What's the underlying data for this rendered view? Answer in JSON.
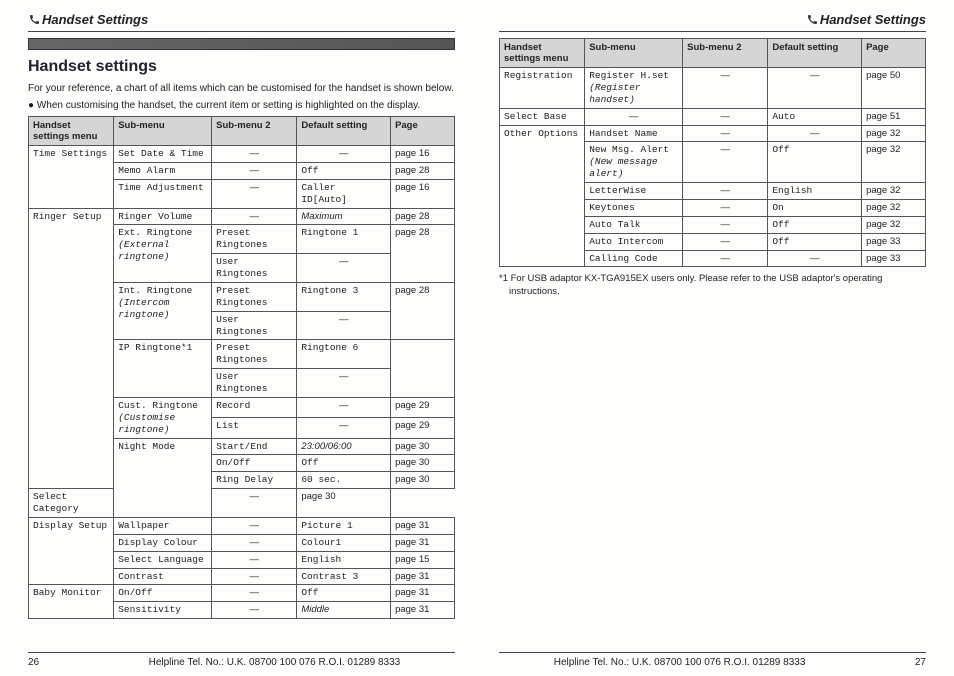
{
  "header_title": "Handset Settings",
  "section_title": "Handset settings",
  "intro": "For your reference, a chart of all items which can be customised for the handset is shown below.",
  "bullet": "● When customising the handset, the current item or setting is highlighted on the display.",
  "columns": {
    "c1": "Handset settings menu",
    "c2": "Sub-menu",
    "c3": "Sub-menu 2",
    "c4": "Default setting",
    "c5": "Page"
  },
  "left_rows": [
    {
      "menu": "Time Settings",
      "sub": "Set Date & Time",
      "sub2": "—",
      "def": "—",
      "page": "page 16",
      "menu_rowspan": 3,
      "mono_sub": true
    },
    {
      "sub": "Memo Alarm",
      "sub2": "—",
      "def": "Off",
      "page": "page 28",
      "mono_sub": true,
      "mono_def": true
    },
    {
      "sub": "Time Adjustment",
      "sub2": "—",
      "def": "Caller ID[Auto]",
      "page": "page 16",
      "mono_sub": true,
      "mono_def": true
    },
    {
      "menu": "Ringer Setup",
      "sub": "Ringer Volume",
      "sub2": "—",
      "def": "Maximum",
      "def_italic": true,
      "page": "page 28",
      "menu_rowspan": 12,
      "mono_sub": true
    },
    {
      "sub": "Ext. Ringtone",
      "sub_note": "(External ringtone)",
      "sub2": "Preset Ringtones",
      "def": "Ringtone  1",
      "page": "page 28",
      "sub_rowspan": 2,
      "mono_sub": true,
      "mono_sub2": true,
      "mono_def": true
    },
    {
      "sub2": "User Ringtones",
      "def": "—",
      "page": "",
      "mono_sub2": true,
      "page_merge_up": true
    },
    {
      "sub": "Int. Ringtone",
      "sub_note": "(Intercom ringtone)",
      "sub2": "Preset Ringtones",
      "def": "Ringtone  3",
      "page": "page 28",
      "sub_rowspan": 2,
      "mono_sub": true,
      "mono_sub2": true,
      "mono_def": true
    },
    {
      "sub2": "User Ringtones",
      "def": "—",
      "page": "",
      "mono_sub2": true,
      "page_merge_up": true
    },
    {
      "sub": "IP Ringtone*1",
      "sub2": "Preset Ringtones",
      "def": "Ringtone  6",
      "page": "",
      "sub_rowspan": 2,
      "page_rowspan": 2,
      "mono_sub": true,
      "mono_sub2": true,
      "mono_def": true,
      "def_rowspan": 1
    },
    {
      "sub2": "User Ringtones",
      "def": "—",
      "mono_sub2": true,
      "page_skip": true
    },
    {
      "sub": "Cust. Ringtone",
      "sub_note": "(Customise ringtone)",
      "sub2": "Record",
      "def": "—",
      "page": "page 29",
      "sub_rowspan": 2,
      "mono_sub": true,
      "mono_sub2": true
    },
    {
      "sub2": "List",
      "def": "—",
      "page": "page 29",
      "mono_sub2": true
    },
    {
      "sub": "Night Mode",
      "sub2": "Start/End",
      "def": "23:00/06:00",
      "def_italic": true,
      "page": "page 30",
      "sub_rowspan": 4,
      "mono_sub": true,
      "mono_sub2": true
    },
    {
      "sub2": "On/Off",
      "def": "Off",
      "page": "page 30",
      "mono_sub2": true,
      "mono_def": true
    },
    {
      "sub2": "Ring Delay",
      "def": "60 sec.",
      "page": "page 30",
      "mono_sub2": true,
      "mono_def": true
    },
    {
      "sub2": "Select Category",
      "def": "—",
      "page": "page 30",
      "mono_sub2": true
    },
    {
      "menu": "Display Setup",
      "sub": "Wallpaper",
      "sub2": "—",
      "def": "Picture 1",
      "page": "page 31",
      "menu_rowspan": 4,
      "mono_sub": true,
      "mono_def": true
    },
    {
      "sub": "Display Colour",
      "sub2": "—",
      "def": "Colour1",
      "page": "page 31",
      "mono_sub": true,
      "mono_def": true
    },
    {
      "sub": "Select Language",
      "sub2": "—",
      "def": "English",
      "page": "page 15",
      "mono_sub": true,
      "mono_def": true
    },
    {
      "sub": "Contrast",
      "sub2": "—",
      "def": "Contrast 3",
      "page": "page 31",
      "mono_sub": true,
      "mono_def": true
    },
    {
      "menu": "Baby Monitor",
      "sub": "On/Off",
      "sub2": "—",
      "def": "Off",
      "page": "page 31",
      "menu_rowspan": 2,
      "mono_sub": true,
      "mono_def": true
    },
    {
      "sub": "Sensitivity",
      "sub2": "—",
      "def": "Middle",
      "def_italic": true,
      "page": "page 31",
      "mono_sub": true
    }
  ],
  "right_rows": [
    {
      "menu": "Registration",
      "sub": "Register H.set",
      "sub_note": "(Register handset)",
      "sub2": "—",
      "def": "—",
      "page": "page 50",
      "mono_sub": true
    },
    {
      "menu": "Select Base",
      "sub": "—",
      "sub2": "—",
      "def": "Auto",
      "page": "page 51",
      "mono_def": true
    },
    {
      "menu": "Other Options",
      "sub": "Handset Name",
      "sub2": "—",
      "def": "—",
      "page": "page 32",
      "menu_rowspan": 7,
      "mono_sub": true
    },
    {
      "sub": "New Msg. Alert",
      "sub_note": "(New message alert)",
      "sub2": "—",
      "def": "Off",
      "page": "page 32",
      "mono_sub": true,
      "mono_def": true
    },
    {
      "sub": "LetterWise",
      "sub2": "—",
      "def": "English",
      "page": "page 32",
      "mono_sub": true,
      "mono_def": true
    },
    {
      "sub": "Keytones",
      "sub2": "—",
      "def": "On",
      "page": "page 32",
      "mono_sub": true,
      "mono_def": true
    },
    {
      "sub": "Auto Talk",
      "sub2": "—",
      "def": "Off",
      "page": "page 32",
      "mono_sub": true,
      "mono_def": true
    },
    {
      "sub": "Auto Intercom",
      "sub2": "—",
      "def": "Off",
      "page": "page 33",
      "mono_sub": true,
      "mono_def": true
    },
    {
      "sub": "Calling Code",
      "sub2": "—",
      "def": "—",
      "page": "page 33",
      "mono_sub": true
    }
  ],
  "footnote": "*1 For USB adaptor KX-TGA915EX users only. Please refer to the USB adaptor's operating instructions.",
  "helpline": "Helpline Tel. No.: U.K. 08700 100 076  R.O.I. 01289 8333",
  "page_left": "26",
  "page_right": "27"
}
